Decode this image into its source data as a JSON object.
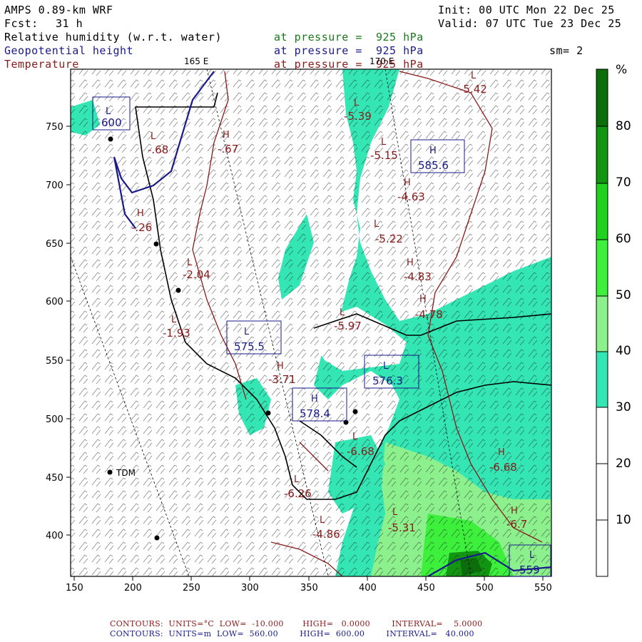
{
  "header": {
    "model": "AMPS 0.89-km WRF",
    "init": "Init: 00 UTC Mon 22 Dec 25",
    "forecast_label": "Fcst:",
    "forecast_hours": "31 h",
    "valid": "Valid: 07 UTC Tue 23 Dec 25",
    "fields": [
      {
        "name": "Relative humidity (w.r.t. water)",
        "level": "at pressure =  925 hPa",
        "color": "#1a7a1a"
      },
      {
        "name": "Geopotential height",
        "level": "at pressure =  925 hPa",
        "color": "#1a1a8a"
      },
      {
        "name": "Temperature",
        "level": "at pressure =  925 hPa",
        "color": "#8a1a1a"
      }
    ],
    "smoothing": "sm= 2"
  },
  "map": {
    "longitude_labels": [
      "165 E",
      "170 E"
    ],
    "x_ticks": [
      "150",
      "200",
      "250",
      "300",
      "350",
      "400",
      "450",
      "500",
      "550"
    ],
    "y_ticks": [
      "750",
      "700",
      "650",
      "600",
      "550",
      "500",
      "450",
      "400"
    ],
    "station": "TDM",
    "height_labels": [
      {
        "type": "L",
        "value": "600"
      },
      {
        "type": "H",
        "value": "585.6"
      },
      {
        "type": "L",
        "value": "575.5"
      },
      {
        "type": "L",
        "value": "576.3"
      },
      {
        "type": "H",
        "value": "578.4"
      },
      {
        "type": "L",
        "value": "559"
      }
    ],
    "temperature_labels": [
      {
        "type": "L",
        "value": "-5.42"
      },
      {
        "type": "L",
        "value": "-5.39"
      },
      {
        "type": "L",
        "value": "-5.15"
      },
      {
        "type": "H",
        "value": "-4.63"
      },
      {
        "type": "L",
        "value": "-5.22"
      },
      {
        "type": "H",
        "value": "-4.83"
      },
      {
        "type": "H",
        "value": "-4.78"
      },
      {
        "type": "L",
        "value": "-5.97"
      },
      {
        "type": "H",
        "value": "-.67"
      },
      {
        "type": "L",
        "value": "-.68"
      },
      {
        "type": "H",
        "value": "-.26"
      },
      {
        "type": "L",
        "value": "-2.04"
      },
      {
        "type": "L",
        "value": "-1.93"
      },
      {
        "type": "H",
        "value": "-3.71"
      },
      {
        "type": "L",
        "value": "-6.68"
      },
      {
        "type": "L",
        "value": "-6.26"
      },
      {
        "type": "L",
        "value": "-4.86"
      },
      {
        "type": "L",
        "value": "-5.31"
      },
      {
        "type": "H",
        "value": "-6.68"
      },
      {
        "type": "H",
        "value": "-6.7"
      }
    ]
  },
  "colorbar": {
    "unit": "%",
    "labels": [
      "80",
      "70",
      "60",
      "50",
      "40",
      "30",
      "20",
      "10"
    ],
    "colors": [
      "#0b6e0b",
      "#129612",
      "#1ed21e",
      "#3cf03c",
      "#8cf08c",
      "#33e6b4",
      "#ffffff",
      "#ffffff"
    ]
  },
  "footer": {
    "temp_contours": "CONTOURS:  UNITS=°C  LOW=  -10.000       HIGH=   0.0000        INTERVAL=    5.0000",
    "height_contours": "CONTOURS:  UNITS=m  LOW=  560.00        HIGH=  600.00        INTERVAL=   40.000"
  }
}
